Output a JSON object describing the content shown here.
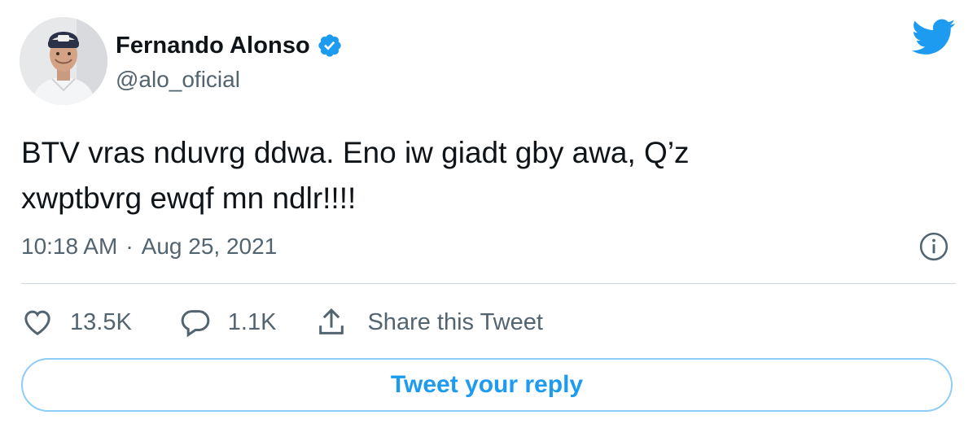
{
  "author": {
    "display_name": "Fernando Alonso",
    "handle": "@alo_oficial",
    "verified": true
  },
  "tweet": {
    "text_lines": [
      "BTV vras nduvrg ddwa. Eno iw giadt gby awa, Q’z",
      "xwptbvrg ewqf mn ndlr!!!!"
    ],
    "time": "10:18 AM",
    "separator": "·",
    "date": "Aug 25, 2021"
  },
  "actions": {
    "likes": "13.5K",
    "replies": "1.1K",
    "share_label": "Share this Tweet"
  },
  "reply_button_label": "Tweet your reply",
  "icons": {
    "avatar": "profile-avatar",
    "verified": "verified-badge-icon",
    "brand": "twitter-bird-icon",
    "info": "info-icon",
    "like": "heart-icon",
    "reply": "speech-bubble-icon",
    "share": "share-upload-icon"
  },
  "colors": {
    "accent": "#1d9bf0",
    "text_primary": "#0f1419",
    "text_secondary": "#536471",
    "divider": "#cfd9de",
    "reply_border": "#8ecdf8"
  }
}
